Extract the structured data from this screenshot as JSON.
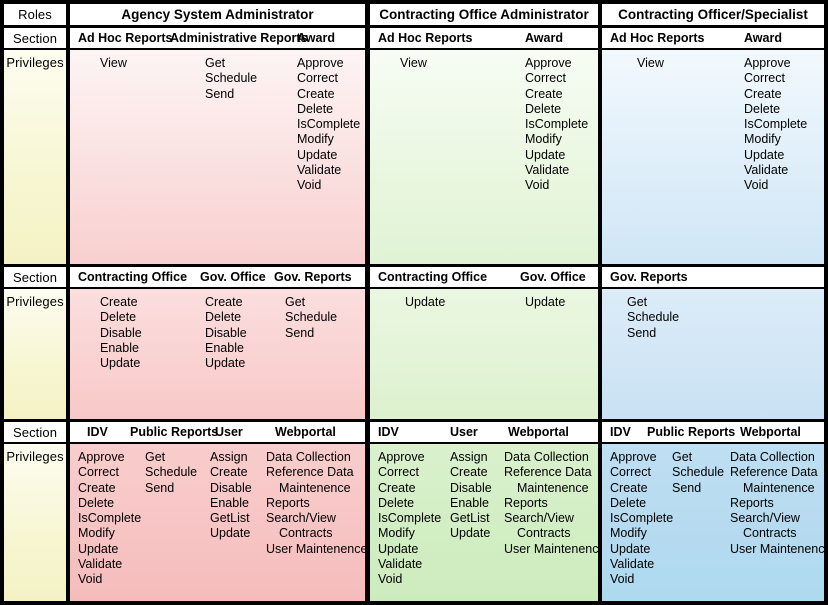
{
  "row_labels": {
    "roles": "Roles",
    "section": "Section",
    "privileges": "Privileges"
  },
  "roles": [
    "Agency System Administrator",
    "Contracting Office Administrator",
    "Contracting Officer/Specialist"
  ],
  "blocks": [
    {
      "id": "block-1",
      "role_index": 0,
      "sections": [
        "Ad Hoc Reports",
        "Administrative Reports",
        "Award"
      ],
      "columns": [
        {
          "section": "Ad Hoc Reports",
          "privileges": [
            "View"
          ]
        },
        {
          "section": "Administrative Reports",
          "privileges": [
            "Get",
            "Schedule",
            "Send"
          ]
        },
        {
          "section": "Award",
          "privileges": [
            "Approve",
            "Correct",
            "Create",
            "Delete",
            "IsComplete",
            "Modify",
            "Update",
            "Validate",
            "Void"
          ]
        }
      ]
    },
    {
      "id": "block-2",
      "role_index": 1,
      "sections": [
        "Ad Hoc Reports",
        "Award"
      ],
      "columns": [
        {
          "section": "Ad Hoc Reports",
          "privileges": [
            "View"
          ]
        },
        {
          "section": "Award",
          "privileges": [
            "Approve",
            "Correct",
            "Create",
            "Delete",
            "IsComplete",
            "Modify",
            "Update",
            "Validate",
            "Void"
          ]
        }
      ]
    },
    {
      "id": "block-3",
      "role_index": 2,
      "sections": [
        "Ad Hoc Reports",
        "Award"
      ],
      "columns": [
        {
          "section": "Ad Hoc Reports",
          "privileges": [
            "View"
          ]
        },
        {
          "section": "Award",
          "privileges": [
            "Approve",
            "Correct",
            "Create",
            "Delete",
            "IsComplete",
            "Modify",
            "Update",
            "Validate",
            "Void"
          ]
        }
      ]
    },
    {
      "id": "block-4",
      "role_index": 0,
      "sections": [
        "Contracting Office",
        "Gov. Office",
        "Gov. Reports"
      ],
      "columns": [
        {
          "section": "Contracting Office",
          "privileges": [
            "Create",
            "Delete",
            "Disable",
            "Enable",
            "Update"
          ]
        },
        {
          "section": "Gov. Office",
          "privileges": [
            "Create",
            "Delete",
            "Disable",
            "Enable",
            "Update"
          ]
        },
        {
          "section": "Gov. Reports",
          "privileges": [
            "Get",
            "Schedule",
            "Send"
          ]
        }
      ]
    },
    {
      "id": "block-5",
      "role_index": 1,
      "sections": [
        "Contracting Office",
        "Gov. Office"
      ],
      "columns": [
        {
          "section": "Contracting Office",
          "privileges": [
            "Update"
          ]
        },
        {
          "section": "Gov. Office",
          "privileges": [
            "Update"
          ]
        }
      ]
    },
    {
      "id": "block-6",
      "role_index": 2,
      "sections": [
        "Gov. Reports"
      ],
      "columns": [
        {
          "section": "Gov. Reports",
          "privileges": [
            "Get",
            "Schedule",
            "Send"
          ]
        }
      ]
    },
    {
      "id": "block-7",
      "role_index": 0,
      "sections": [
        "IDV",
        "Public Reports",
        "User",
        "Webportal"
      ],
      "columns": [
        {
          "section": "IDV",
          "privileges": [
            "Approve",
            "Correct",
            "Create",
            "Delete",
            "IsComplete",
            "Modify",
            "Update",
            "Validate",
            "Void"
          ]
        },
        {
          "section": "Public Reports",
          "privileges": [
            "Get",
            "Schedule",
            "Send"
          ]
        },
        {
          "section": "User",
          "privileges": [
            "Assign",
            "Create",
            "Disable",
            "Enable",
            "GetList",
            "Update"
          ]
        },
        {
          "section": "Webportal",
          "privileges": [
            "Data Collection",
            "Reference Data",
            "Maintenence",
            "Reports",
            "Search/View",
            "Contracts",
            "User Maintenence"
          ]
        }
      ]
    },
    {
      "id": "block-8",
      "role_index": 1,
      "sections": [
        "IDV",
        "User",
        "Webportal"
      ],
      "columns": [
        {
          "section": "IDV",
          "privileges": [
            "Approve",
            "Correct",
            "Create",
            "Delete",
            "IsComplete",
            "Modify",
            "Update",
            "Validate",
            "Void"
          ]
        },
        {
          "section": "User",
          "privileges": [
            "Assign",
            "Create",
            "Disable",
            "Enable",
            "GetList",
            "Update"
          ]
        },
        {
          "section": "Webportal",
          "privileges": [
            "Data Collection",
            "Reference Data",
            "Maintenence",
            "Reports",
            "Search/View",
            "Contracts",
            "User Maintenence"
          ]
        }
      ]
    },
    {
      "id": "block-9",
      "role_index": 2,
      "sections": [
        "IDV",
        "Public Reports",
        "Webportal"
      ],
      "columns": [
        {
          "section": "IDV",
          "privileges": [
            "Approve",
            "Correct",
            "Create",
            "Delete",
            "IsComplete",
            "Modify",
            "Update",
            "Validate",
            "Void"
          ]
        },
        {
          "section": "Public Reports",
          "privileges": [
            "Get",
            "Schedule",
            "Send"
          ]
        },
        {
          "section": "Webportal",
          "privileges": [
            "Data Collection",
            "Reference Data",
            "Maintenence",
            "Reports",
            "Search/View",
            "Contracts",
            "User Maintenence"
          ]
        }
      ]
    }
  ],
  "colors": {
    "role_1_accent": "#f9cfcf",
    "role_2_accent": "#e0f3d4",
    "role_3_accent": "#cfe6f6",
    "label_accent": "#f4f2c4",
    "border": "#000000"
  }
}
